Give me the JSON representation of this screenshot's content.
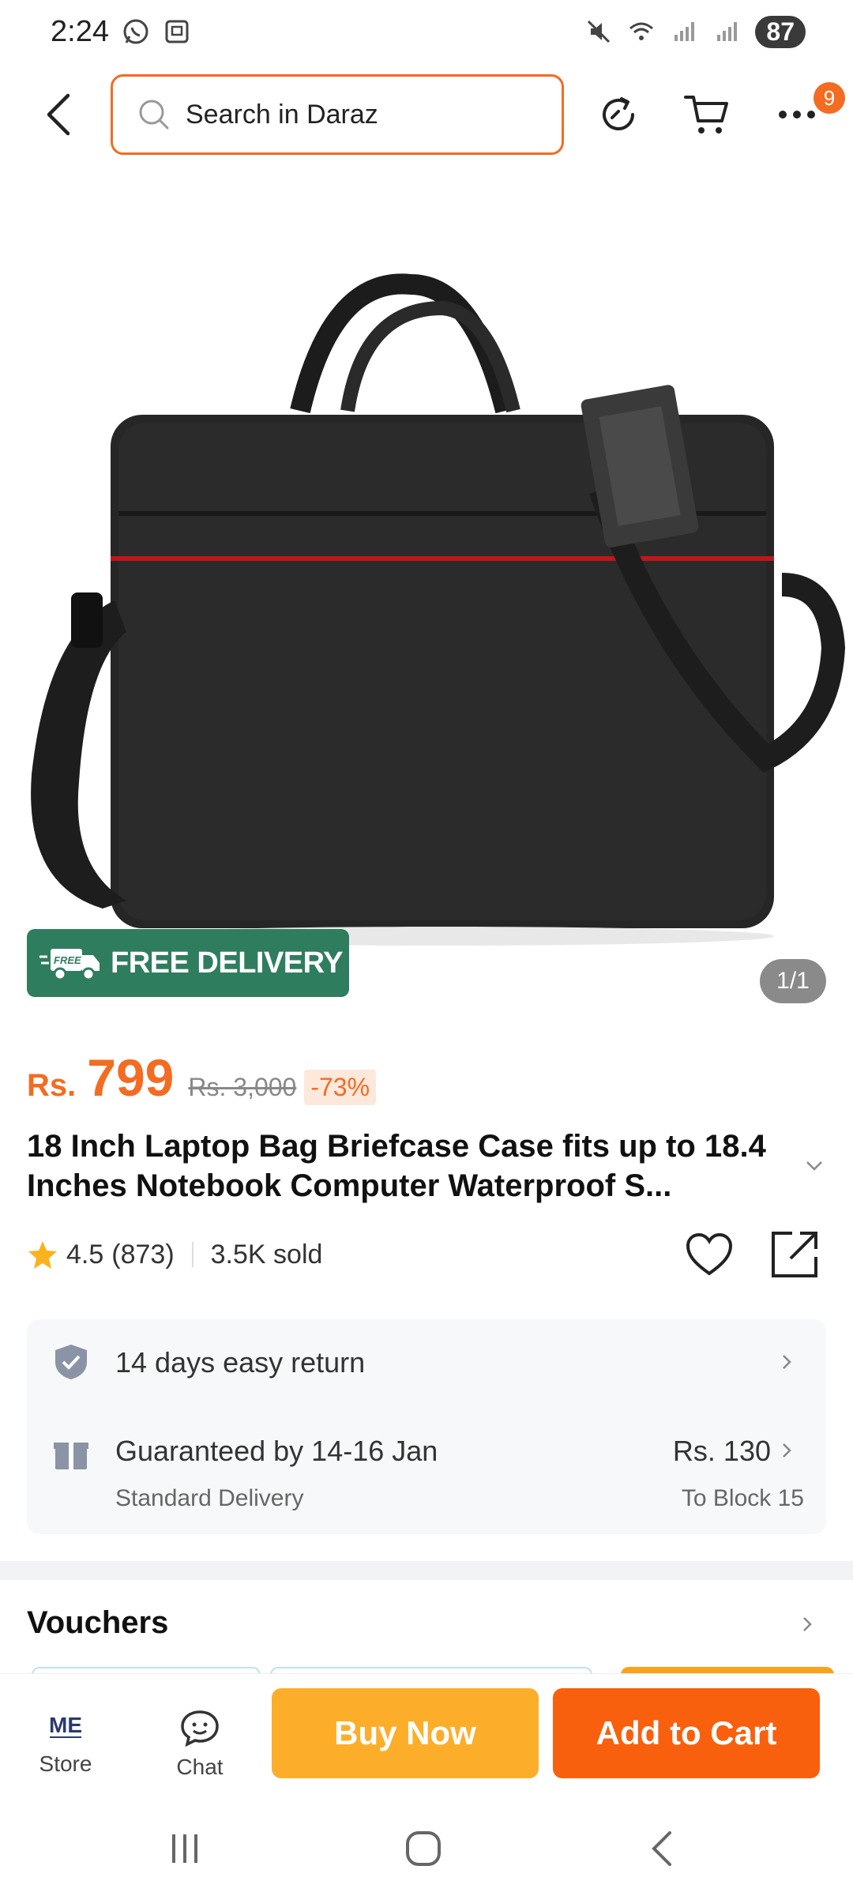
{
  "status_bar": {
    "time": "2:24",
    "battery": "87",
    "icons": [
      "whatsapp-icon",
      "screenshot-icon",
      "mute-icon",
      "wifi-icon",
      "signal-icon",
      "signal-icon"
    ]
  },
  "nav": {
    "search_placeholder": "Search in Daraz",
    "menu_badge": "9",
    "accent_color": "#f36c21"
  },
  "product": {
    "free_delivery_label": "FREE DELIVERY",
    "free_badge_text": "FREE",
    "image_counter": "1/1",
    "currency": "Rs.",
    "price": "799",
    "original_price": "Rs. 3,000",
    "discount": "-73%",
    "title": "18 Inch Laptop Bag Briefcase Case fits up to 18.4 Inches Notebook Computer Waterproof S...",
    "rating": "4.5",
    "reviews": "(873)",
    "sold": "3.5K sold"
  },
  "services": {
    "return_label": "14 days easy return",
    "delivery_label": "Guaranteed by 14-16 Jan",
    "delivery_sub": "Standard Delivery",
    "delivery_price": "Rs. 130",
    "delivery_location": "To Block 15"
  },
  "vouchers": {
    "title": "Vouchers"
  },
  "action_bar": {
    "store_label": "Store",
    "store_logo": "ME",
    "chat_label": "Chat",
    "buy_now": "Buy Now",
    "add_to_cart": "Add to Cart",
    "buy_color": "#fcae2a",
    "cart_color": "#f8600e"
  }
}
